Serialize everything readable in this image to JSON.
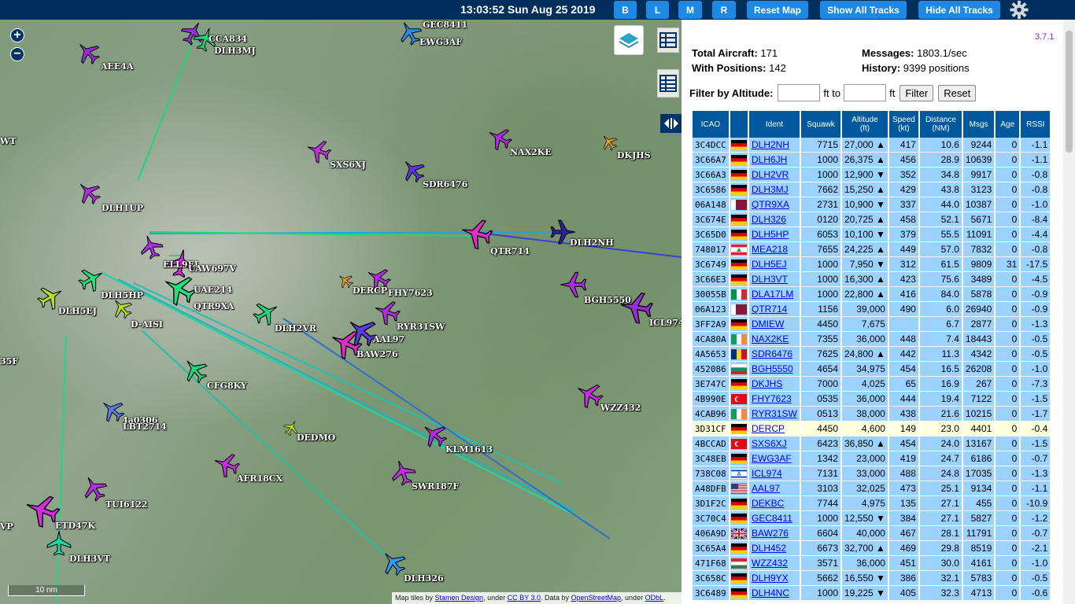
{
  "header": {
    "clock": "13:03:52 Sun Aug 25 2019",
    "buttons": [
      "B",
      "L",
      "M",
      "R",
      "Reset Map",
      "Show All Tracks",
      "Hide All Tracks"
    ]
  },
  "map": {
    "zoom_in": "+",
    "zoom_out": "−",
    "scale_label": "10 nm",
    "attribution": {
      "prefix": "Map tiles by ",
      "stamen": "Stamen Design",
      "under1": ", under ",
      "ccby": "CC BY 3.0",
      "data_by": ". Data by ",
      "osm": "OpenStreetMap",
      "under2": ", under ",
      "odbl": "ODbL",
      "end": "."
    },
    "labels": [
      "CCA834",
      "DLH3MJ",
      "AEE4A",
      "GEC8411",
      "EWG3AF",
      "WT",
      "NAX2KE",
      "DKJHS",
      "SXS6XJ",
      "SDR6476",
      "DLH1UP",
      "DLH2NH",
      "QTR714",
      "DLH5HP",
      "UAE214",
      "QTR9XA",
      "DLH5EJ",
      "D-AISI",
      "DLH2VR",
      "DERCP",
      "FHY7623",
      "RYR31SW",
      "AAL97",
      "BAW276",
      "BGH5550",
      "ICL974",
      "35F",
      "CFG8KY",
      "4a0306",
      "LBT2714",
      "DEDMO",
      "KLM1613",
      "WZZ432",
      "AFR18CX",
      "SWR187F",
      "TUI6122",
      "ETD47K",
      "VP",
      "DLH3VT",
      "DLH326",
      "ELL9EL",
      "UAW697V"
    ]
  },
  "panel": {
    "version": "3.7.1",
    "total_aircraft_label": "Total Aircraft:",
    "total_aircraft": "171",
    "with_positions_label": "With Positions:",
    "with_positions": "142",
    "messages_label": "Messages:",
    "messages": "1803.1/sec",
    "history_label": "History:",
    "history": "9399 positions",
    "filter_label": "Filter by Altitude:",
    "filter_to": "ft to",
    "filter_ft": "ft",
    "filter_button": "Filter",
    "reset_button": "Reset"
  },
  "table": {
    "headers": [
      "ICAO",
      "",
      "Ident",
      "Squawk",
      "Altitude\n(ft)",
      "Speed\n(kt)",
      "Distance\n(NM)",
      "Msgs",
      "Age",
      "RSSI"
    ],
    "rows": [
      [
        "3C4DCC",
        "de",
        "DLH2NH",
        "7715",
        "27,000 ▲",
        "417",
        "10.6",
        "9244",
        "0",
        "-1.1"
      ],
      [
        "3C66A7",
        "de",
        "DLH6JH",
        "1000",
        "26,375 ▲",
        "456",
        "28.9",
        "10639",
        "0",
        "-1.1"
      ],
      [
        "3C66A3",
        "de",
        "DLH2VR",
        "1000",
        "12,900 ▼",
        "352",
        "34.8",
        "9917",
        "0",
        "-0.8"
      ],
      [
        "3C6586",
        "de",
        "DLH3MJ",
        "7662",
        "15,250 ▲",
        "429",
        "43.8",
        "3123",
        "0",
        "-0.8"
      ],
      [
        "06A148",
        "qa",
        "QTR9XA",
        "2731",
        "10,900 ▼",
        "337",
        "44.0",
        "10387",
        "0",
        "-1.0"
      ],
      [
        "3C674E",
        "de",
        "DLH326",
        "0120",
        "20,725 ▲",
        "458",
        "52.1",
        "5671",
        "0",
        "-8.4"
      ],
      [
        "3C65D0",
        "de",
        "DLH5HP",
        "6053",
        "10,100 ▼",
        "379",
        "55.5",
        "11091",
        "0",
        "-4.4"
      ],
      [
        "748017",
        "lb",
        "MEA218",
        "7655",
        "24,225 ▲",
        "449",
        "57.0",
        "7832",
        "0",
        "-0.8"
      ],
      [
        "3C6749",
        "de",
        "DLH5EJ",
        "1000",
        "7,950 ▼",
        "312",
        "61.5",
        "9809",
        "31",
        "-17.5"
      ],
      [
        "3C66E3",
        "de",
        "DLH3VT",
        "1000",
        "16,300 ▲",
        "423",
        "75.6",
        "3489",
        "0",
        "-4.5"
      ],
      [
        "30055B",
        "it",
        "DLA17LM",
        "1000",
        "22,800 ▲",
        "416",
        "84.0",
        "5878",
        "0",
        "-0.9"
      ],
      [
        "06A123",
        "qa",
        "QTR714",
        "1156",
        "39,000",
        "490",
        "6.0",
        "26940",
        "0",
        "-0.9"
      ],
      [
        "3FF2A9",
        "de",
        "DMIEW",
        "4450",
        "7,675",
        "",
        "6.7",
        "2877",
        "0",
        "-1.3"
      ],
      [
        "4CA80A",
        "ie",
        "NAX2KE",
        "7355",
        "36,000",
        "448",
        "7.4",
        "18443",
        "0",
        "-0.5"
      ],
      [
        "4A5653",
        "ro",
        "SDR6476",
        "7625",
        "24,800 ▲",
        "442",
        "11.3",
        "4342",
        "0",
        "-0.5"
      ],
      [
        "452086",
        "bg",
        "BGH5550",
        "4654",
        "34,975",
        "454",
        "16.5",
        "26208",
        "0",
        "-1.0"
      ],
      [
        "3E747C",
        "de",
        "DKJHS",
        "7000",
        "4,025",
        "65",
        "16.9",
        "267",
        "0",
        "-7.3"
      ],
      [
        "4B990E",
        "tr",
        "FHY7623",
        "0535",
        "36,000",
        "444",
        "19.4",
        "7122",
        "0",
        "-1.5"
      ],
      [
        "4CAB96",
        "ie",
        "RYR31SW",
        "0513",
        "38,000",
        "438",
        "21.6",
        "10215",
        "0",
        "-1.7"
      ],
      [
        "3D31CF",
        "de",
        "DERCP",
        "4450",
        "4,600",
        "149",
        "23.0",
        "4401",
        "0",
        "-0.4"
      ],
      [
        "4BCCAD",
        "tr",
        "SXS6XJ",
        "6423",
        "36,850 ▲",
        "454",
        "24.0",
        "13167",
        "0",
        "-1.5"
      ],
      [
        "3C48EB",
        "de",
        "EWG3AF",
        "1342",
        "23,000",
        "419",
        "24.7",
        "6186",
        "0",
        "-0.7"
      ],
      [
        "738C08",
        "il",
        "ICL974",
        "7131",
        "33,000",
        "488",
        "24.8",
        "17035",
        "0",
        "-1.3"
      ],
      [
        "A48DFB",
        "us",
        "AAL97",
        "3103",
        "32,025",
        "473",
        "25.1",
        "9134",
        "0",
        "-1.1"
      ],
      [
        "3D1F2C",
        "de",
        "DEKBC",
        "7744",
        "4,975",
        "135",
        "27.1",
        "455",
        "0",
        "-10.9"
      ],
      [
        "3C70C4",
        "de",
        "GEC8411",
        "1000",
        "12,550 ▼",
        "384",
        "27.1",
        "5827",
        "0",
        "-1.2"
      ],
      [
        "406A9D",
        "gb",
        "BAW276",
        "6604",
        "40,000",
        "467",
        "28.1",
        "11791",
        "0",
        "-0.7"
      ],
      [
        "3C65A4",
        "de",
        "DLH452",
        "6673",
        "32,700 ▲",
        "469",
        "29.8",
        "8519",
        "0",
        "-2.1"
      ],
      [
        "471F68",
        "hu",
        "WZZ432",
        "3571",
        "36,000",
        "451",
        "30.0",
        "4161",
        "0",
        "-1.0"
      ],
      [
        "3C658C",
        "de",
        "DLH9YX",
        "5662",
        "16,550 ▼",
        "386",
        "32.1",
        "5783",
        "0",
        "-0.5"
      ],
      [
        "3C6489",
        "de",
        "DLH4NC",
        "1000",
        "19,225 ▼",
        "405",
        "32.3",
        "4713",
        "0",
        "-0.6"
      ]
    ]
  }
}
